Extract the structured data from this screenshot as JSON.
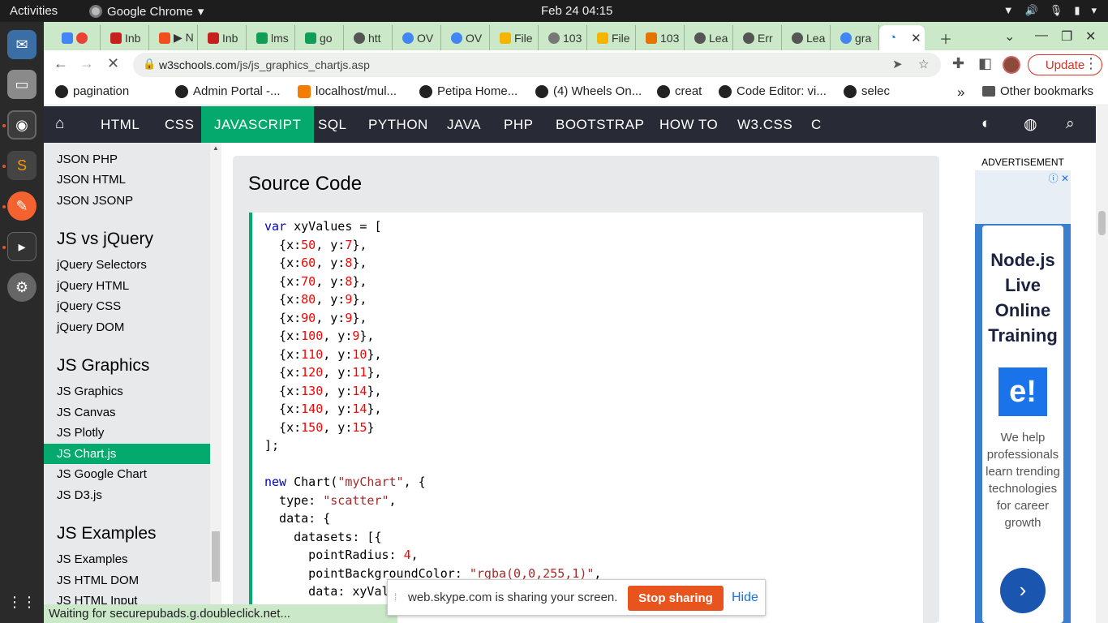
{
  "topbar": {
    "activities": "Activities",
    "app_name": "Google Chrome",
    "clock": "Feb 24  04:15"
  },
  "tabs": [
    {
      "label": "",
      "color": "#ea4335"
    },
    {
      "label": "Inb",
      "color": "#c5221f"
    },
    {
      "label": "▶ N",
      "color": "#f24e1e"
    },
    {
      "label": "Inb",
      "color": "#c5221f"
    },
    {
      "label": "lms",
      "color": "#0f9d58"
    },
    {
      "label": "go",
      "color": "#0f9d58"
    },
    {
      "label": "htt",
      "color": "#555555"
    },
    {
      "label": "OV",
      "color": "#4285f4"
    },
    {
      "label": "OV",
      "color": "#4285f4"
    },
    {
      "label": "File",
      "color": "#f4b400"
    },
    {
      "label": "103",
      "color": "#777777"
    },
    {
      "label": "File",
      "color": "#f4b400"
    },
    {
      "label": "103",
      "color": "#e37400"
    },
    {
      "label": "Lea",
      "color": "#555555"
    },
    {
      "label": "Err",
      "color": "#555555"
    },
    {
      "label": "Lea",
      "color": "#555555"
    },
    {
      "label": "gra",
      "color": "#4285f4"
    },
    {
      "label": "",
      "color": "#ffffff"
    }
  ],
  "omnibox": {
    "host": "w3schools.com",
    "path": "/js/js_graphics_chartjs.asp"
  },
  "update_label": "Update",
  "bookmarks": [
    "pagination",
    "Admin Portal -...",
    "localhost/mul...",
    "Petipa Home...",
    "(4) Wheels On...",
    "creat",
    "Code Editor: vi...",
    "selec"
  ],
  "other_bookmarks": "Other bookmarks",
  "w3nav": [
    "HTML",
    "CSS",
    "JAVASCRIPT",
    "SQL",
    "PYTHON",
    "JAVA",
    "PHP",
    "BOOTSTRAP",
    "HOW TO",
    "W3.CSS",
    "C"
  ],
  "sidebar": {
    "items": [
      {
        "type": "link",
        "text": "JSON PHP"
      },
      {
        "type": "link",
        "text": "JSON HTML"
      },
      {
        "type": "link",
        "text": "JSON JSONP"
      },
      {
        "type": "head",
        "text": "JS vs jQuery"
      },
      {
        "type": "link",
        "text": "jQuery Selectors"
      },
      {
        "type": "link",
        "text": "jQuery HTML"
      },
      {
        "type": "link",
        "text": "jQuery CSS"
      },
      {
        "type": "link",
        "text": "jQuery DOM"
      },
      {
        "type": "head",
        "text": "JS Graphics"
      },
      {
        "type": "link",
        "text": "JS Graphics"
      },
      {
        "type": "link",
        "text": "JS Canvas"
      },
      {
        "type": "link",
        "text": "JS Plotly"
      },
      {
        "type": "active",
        "text": "JS Chart.js"
      },
      {
        "type": "link",
        "text": "JS Google Chart"
      },
      {
        "type": "link",
        "text": "JS D3.js"
      },
      {
        "type": "head",
        "text": "JS Examples"
      },
      {
        "type": "link",
        "text": "JS Examples"
      },
      {
        "type": "link",
        "text": "JS HTML DOM"
      },
      {
        "type": "link",
        "text": "JS HTML Input"
      }
    ]
  },
  "main": {
    "title": "Source Code",
    "code_lines": [
      [
        [
          "kw",
          "var"
        ],
        [
          "",
          " xyValues = ["
        ]
      ],
      [
        [
          "",
          "  {x:"
        ],
        [
          "num",
          "50"
        ],
        [
          "",
          ", y:"
        ],
        [
          "num",
          "7"
        ],
        [
          "",
          "},"
        ]
      ],
      [
        [
          "",
          "  {x:"
        ],
        [
          "num",
          "60"
        ],
        [
          "",
          ", y:"
        ],
        [
          "num",
          "8"
        ],
        [
          "",
          "},"
        ]
      ],
      [
        [
          "",
          "  {x:"
        ],
        [
          "num",
          "70"
        ],
        [
          "",
          ", y:"
        ],
        [
          "num",
          "8"
        ],
        [
          "",
          "},"
        ]
      ],
      [
        [
          "",
          "  {x:"
        ],
        [
          "num",
          "80"
        ],
        [
          "",
          ", y:"
        ],
        [
          "num",
          "9"
        ],
        [
          "",
          "},"
        ]
      ],
      [
        [
          "",
          "  {x:"
        ],
        [
          "num",
          "90"
        ],
        [
          "",
          ", y:"
        ],
        [
          "num",
          "9"
        ],
        [
          "",
          "},"
        ]
      ],
      [
        [
          "",
          "  {x:"
        ],
        [
          "num",
          "100"
        ],
        [
          "",
          ", y:"
        ],
        [
          "num",
          "9"
        ],
        [
          "",
          "},"
        ]
      ],
      [
        [
          "",
          "  {x:"
        ],
        [
          "num",
          "110"
        ],
        [
          "",
          ", y:"
        ],
        [
          "num",
          "10"
        ],
        [
          "",
          "},"
        ]
      ],
      [
        [
          "",
          "  {x:"
        ],
        [
          "num",
          "120"
        ],
        [
          "",
          ", y:"
        ],
        [
          "num",
          "11"
        ],
        [
          "",
          "},"
        ]
      ],
      [
        [
          "",
          "  {x:"
        ],
        [
          "num",
          "130"
        ],
        [
          "",
          ", y:"
        ],
        [
          "num",
          "14"
        ],
        [
          "",
          "},"
        ]
      ],
      [
        [
          "",
          "  {x:"
        ],
        [
          "num",
          "140"
        ],
        [
          "",
          ", y:"
        ],
        [
          "num",
          "14"
        ],
        [
          "",
          "},"
        ]
      ],
      [
        [
          "",
          "  {x:"
        ],
        [
          "num",
          "150"
        ],
        [
          "",
          ", y:"
        ],
        [
          "num",
          "15"
        ],
        [
          "",
          "}"
        ]
      ],
      [
        [
          "",
          "];"
        ]
      ],
      [
        [
          "",
          ""
        ]
      ],
      [
        [
          "kw",
          "new"
        ],
        [
          "",
          " Chart("
        ],
        [
          "str",
          "\"myChart\""
        ],
        [
          "",
          ", {"
        ]
      ],
      [
        [
          "",
          "  type: "
        ],
        [
          "str",
          "\"scatter\""
        ],
        [
          "",
          ","
        ]
      ],
      [
        [
          "",
          "  data: {"
        ]
      ],
      [
        [
          "",
          "    datasets: [{"
        ]
      ],
      [
        [
          "",
          "      pointRadius: "
        ],
        [
          "num",
          "4"
        ],
        [
          "",
          ","
        ]
      ],
      [
        [
          "",
          "      pointBackgroundColor: "
        ],
        [
          "str",
          "\"rgba(0,0,255,1)\""
        ],
        [
          "",
          ","
        ]
      ],
      [
        [
          "",
          "      data: xyValues"
        ]
      ]
    ]
  },
  "ad": {
    "label": "ADVERTISEMENT",
    "title": "Node.js Live Online Training",
    "logo": "e!",
    "desc": "We help professionals learn trending technologies for career growth"
  },
  "status": "Waiting for securepubads.g.doubleclick.net...",
  "sharebar": {
    "text": "web.skype.com is sharing your screen.",
    "stop": "Stop sharing",
    "hide": "Hide"
  },
  "colors": {
    "w3_green": "#04aa6d",
    "w3_dark": "#282a35",
    "tabstrip": "#cbe8c8",
    "stop_button": "#e8541e"
  }
}
